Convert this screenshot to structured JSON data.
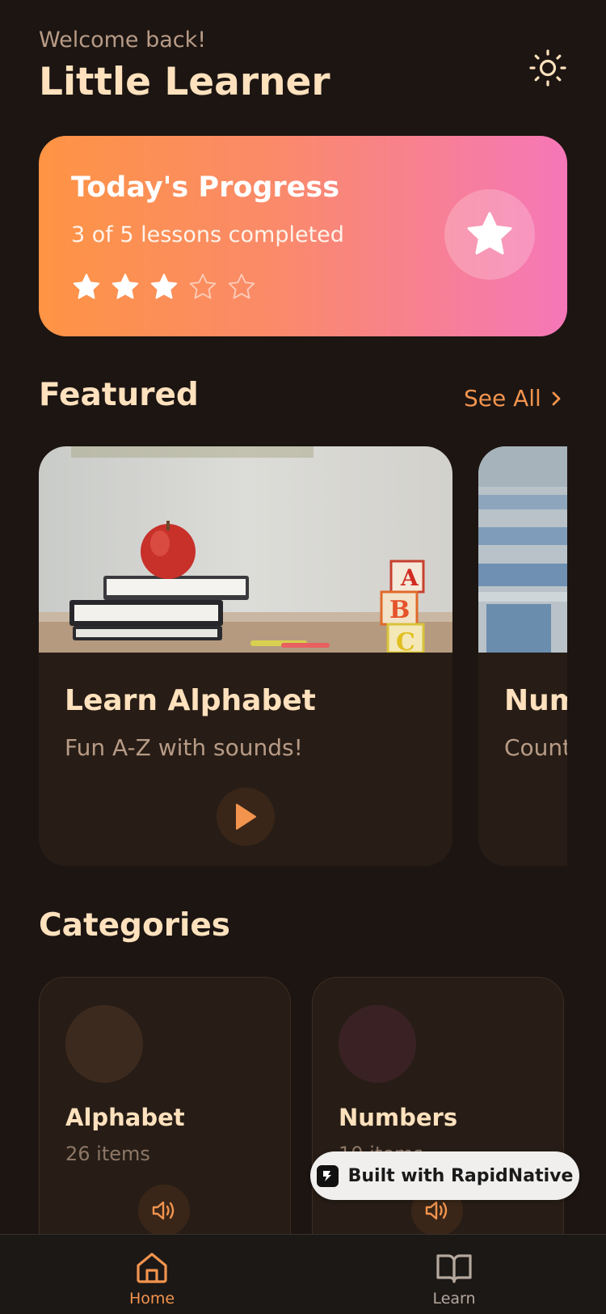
{
  "header": {
    "welcome": "Welcome back!",
    "title": "Little Learner",
    "theme_icon": "sun-icon"
  },
  "progress": {
    "title": "Today's Progress",
    "subtitle": "3 of 5 lessons completed",
    "completed": 3,
    "total": 5
  },
  "featured": {
    "title": "Featured",
    "see_all": "See All",
    "cards": [
      {
        "title": "Learn Alphabet",
        "subtitle": "Fun A-Z with sounds!"
      },
      {
        "title": "Numbers",
        "subtitle": "Counting"
      }
    ]
  },
  "categories": {
    "title": "Categories",
    "items": [
      {
        "name": "Alphabet",
        "count": "26 items",
        "color": "#3d2a1e"
      },
      {
        "name": "Numbers",
        "count": "10 items",
        "color": "#3a2224"
      }
    ]
  },
  "badge": {
    "text": "Built with RapidNative"
  },
  "tabs": [
    {
      "label": "Home",
      "icon": "home-icon",
      "active": true
    },
    {
      "label": "Learn",
      "icon": "book-icon",
      "active": false
    }
  ],
  "colors": {
    "background": "#1c1512",
    "accent": "#f2944e",
    "title": "#ffe1bd",
    "gradient_start": "#fe9444",
    "gradient_end": "#f577b8"
  }
}
